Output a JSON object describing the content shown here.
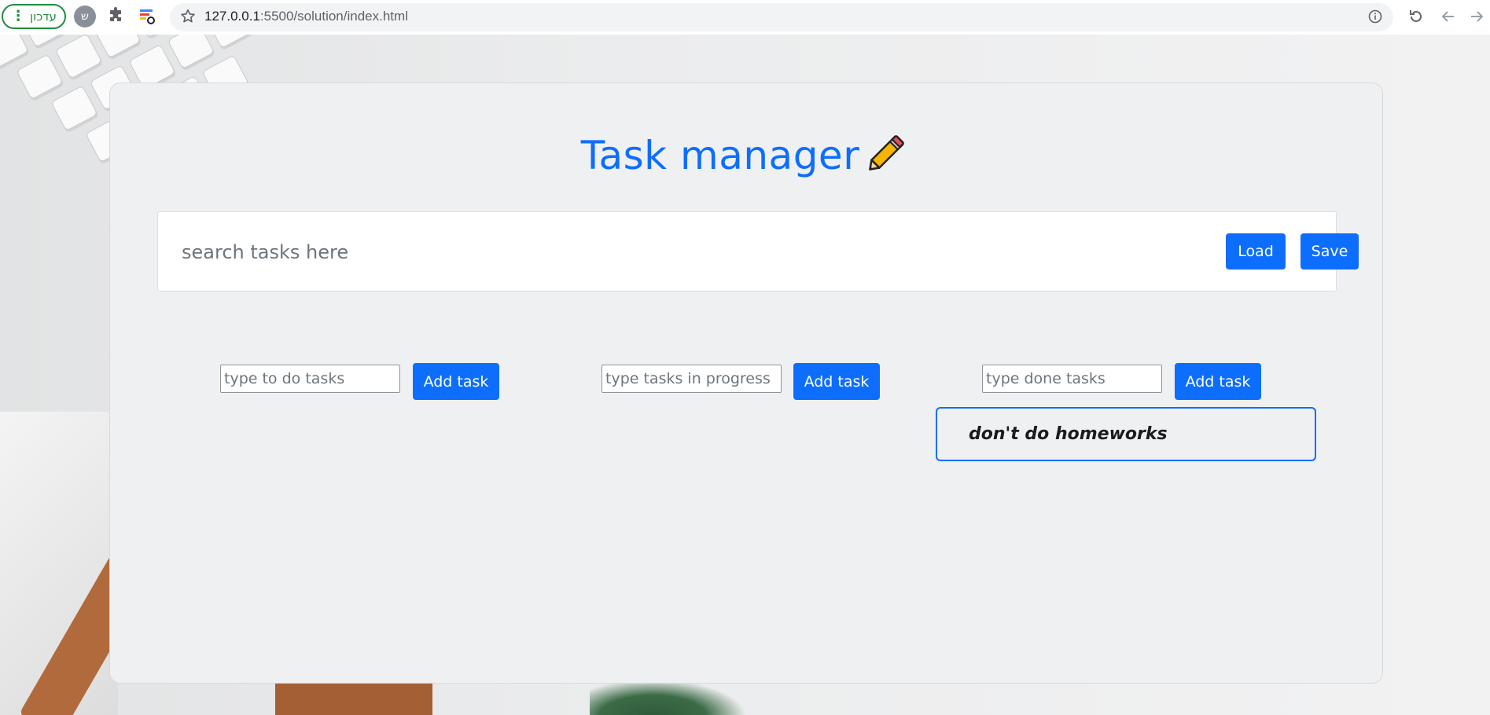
{
  "browser": {
    "update_label": "עדכון",
    "profile_initial": "ש",
    "url_host": "127.0.0.1",
    "url_path": ":5500/solution/index.html"
  },
  "page": {
    "title": "Task manager"
  },
  "search": {
    "placeholder": "search tasks here",
    "value": ""
  },
  "buttons": {
    "load_label": "Load",
    "save_label": "Save"
  },
  "columns": [
    {
      "placeholder": "type to do tasks",
      "add_label": "Add task"
    },
    {
      "placeholder": "type tasks in progress",
      "add_label": "Add task"
    },
    {
      "placeholder": "type done tasks",
      "add_label": "Add task"
    }
  ],
  "tasks": {
    "done": [
      "don't do homeworks"
    ]
  },
  "colors": {
    "accent": "#0d6efd",
    "card_bg": "#eff0f2",
    "update_green": "#1e8e3e"
  },
  "icons": [
    "dots-vertical-icon",
    "puzzle-icon",
    "extension-icon",
    "star-icon",
    "info-icon",
    "reload-icon",
    "back-arrow-icon",
    "forward-arrow-icon",
    "pencil-icon"
  ]
}
